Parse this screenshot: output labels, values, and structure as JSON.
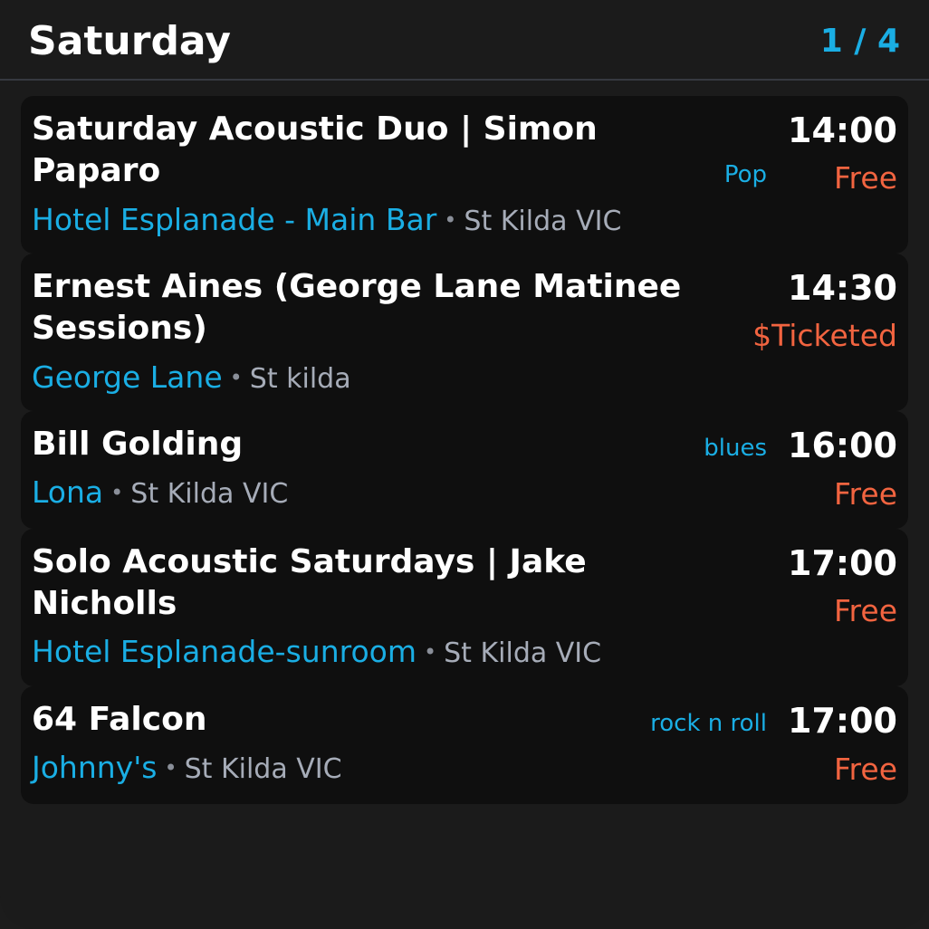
{
  "header": {
    "title": "Saturday",
    "pager": "1 / 4"
  },
  "events": [
    {
      "title": "Saturday Acoustic Duo | Simon Paparo",
      "genre": "Pop",
      "time": "14:00",
      "price": "Free",
      "venue": "Hotel Esplanade - Main Bar",
      "separator": "•",
      "location": "St Kilda VIC"
    },
    {
      "title": "Ernest Aines (George Lane Matinee Sessions)",
      "genre": "",
      "time": "14:30",
      "price": "$Ticketed",
      "venue": "George Lane",
      "separator": "•",
      "location": "St kilda"
    },
    {
      "title": "Bill Golding",
      "genre": "blues",
      "time": "16:00",
      "price": "Free",
      "venue": "Lona",
      "separator": "•",
      "location": "St Kilda VIC"
    },
    {
      "title": "Solo Acoustic Saturdays | Jake Nicholls",
      "genre": "",
      "time": "17:00",
      "price": "Free",
      "venue": "Hotel Esplanade-sunroom",
      "separator": "•",
      "location": "St Kilda VIC"
    },
    {
      "title": "64 Falcon",
      "genre": "rock n roll",
      "time": "17:00",
      "price": "Free",
      "venue": "Johnny's",
      "separator": "•",
      "location": "St Kilda VIC"
    }
  ],
  "colors": {
    "accent": "#1aaee4",
    "price": "#f26440",
    "card_bg": "#0f0f0f",
    "screen_bg": "#1b1b1b"
  }
}
